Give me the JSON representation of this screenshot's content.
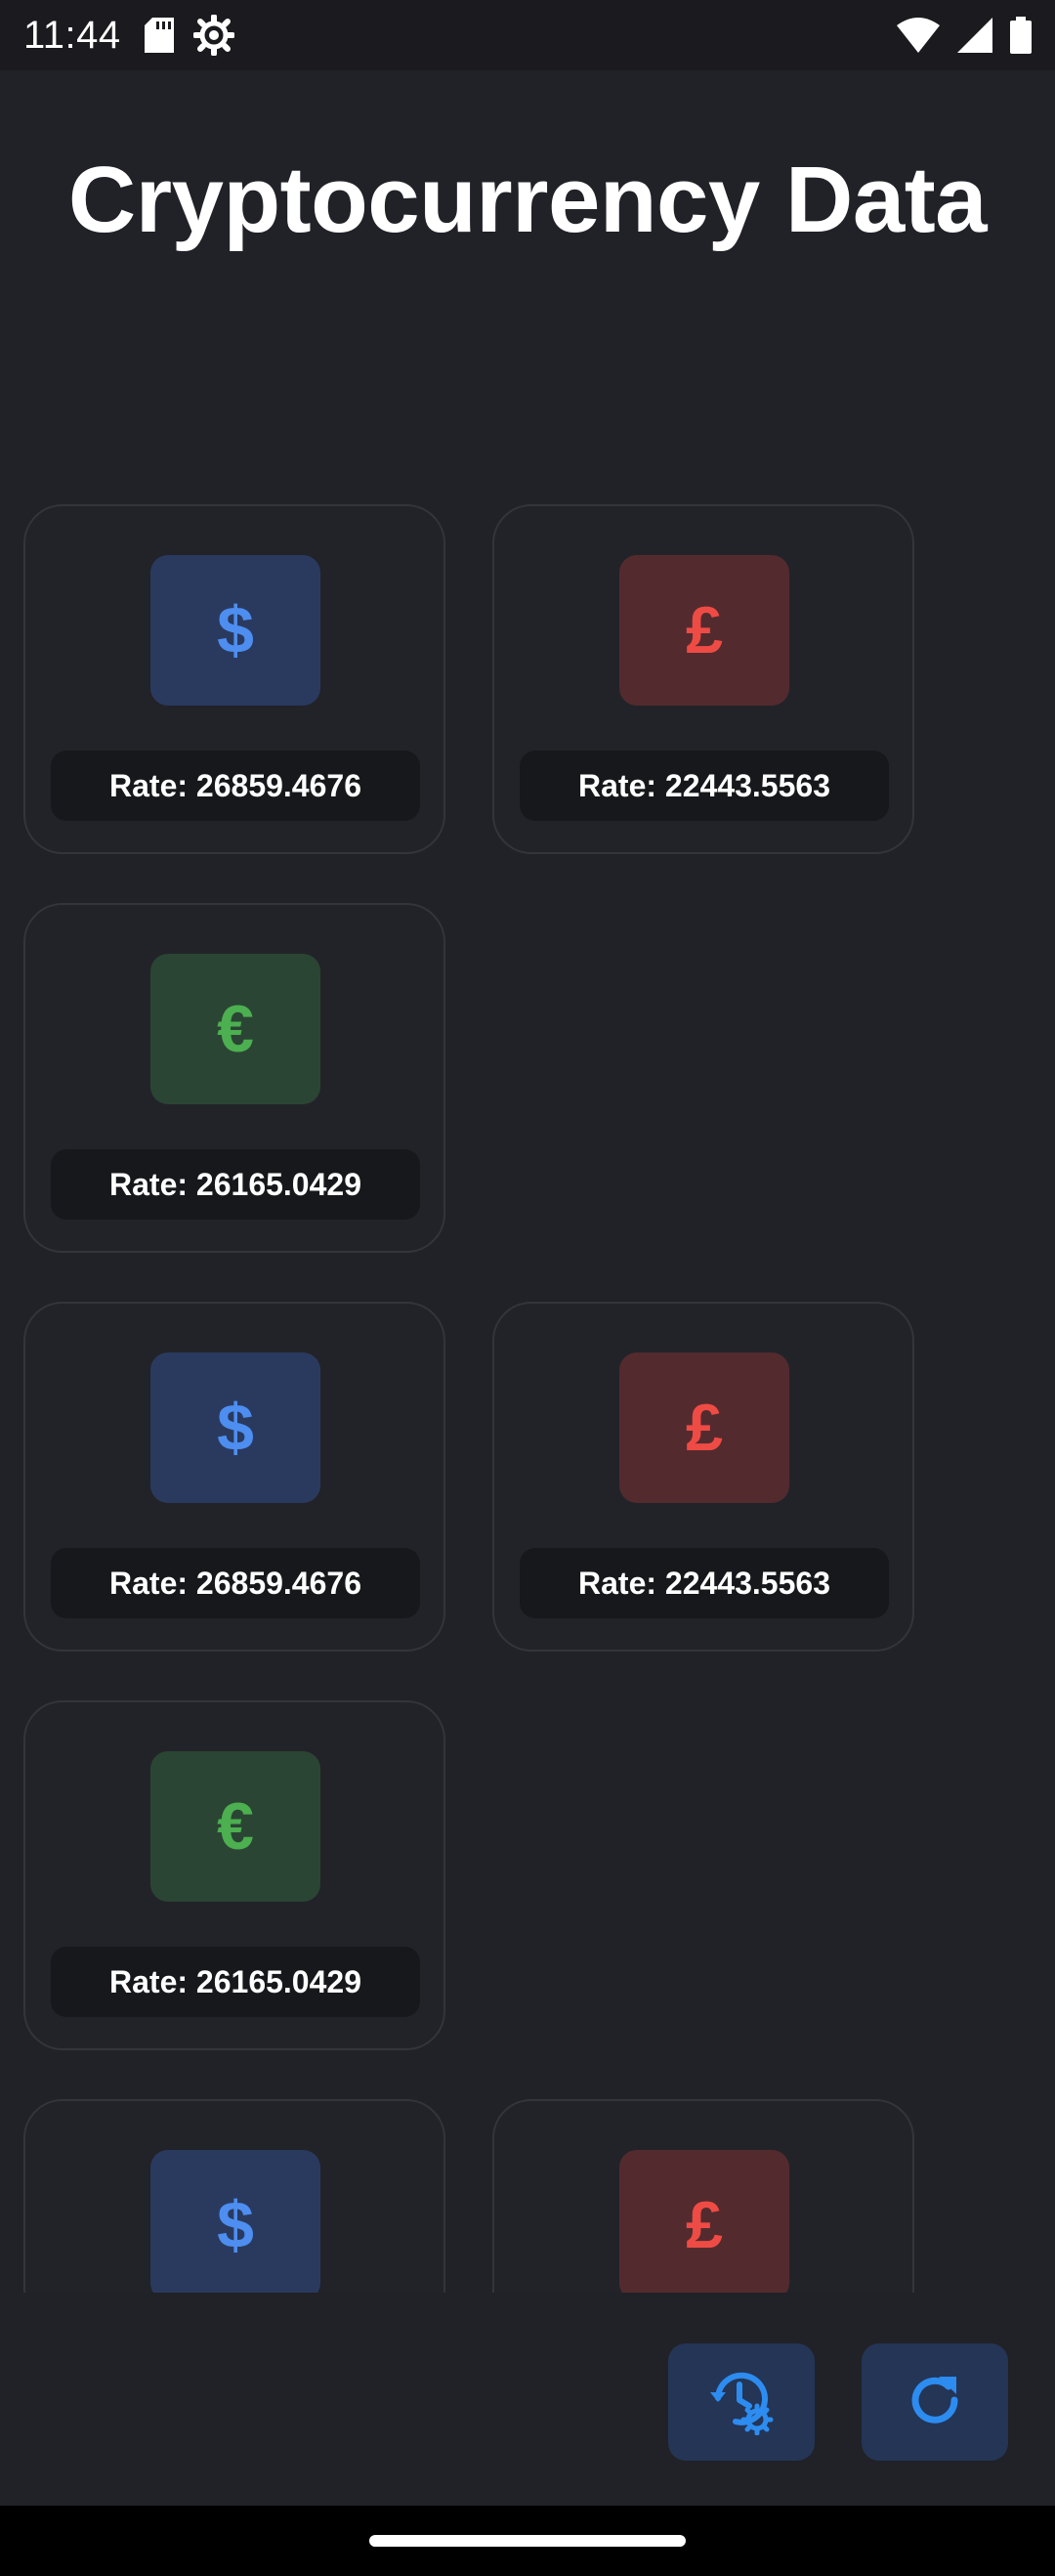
{
  "status_bar": {
    "time": "11:44",
    "left_icons": [
      "sd-card-icon",
      "settings-gear-icon"
    ],
    "right_icons": [
      "wifi-icon",
      "cellular-signal-icon",
      "battery-icon"
    ]
  },
  "header": {
    "title": "Cryptocurrency Data"
  },
  "cards": [
    {
      "currency_symbol": "$",
      "currency": "usd",
      "rate_label": "Rate: 26859.4676"
    },
    {
      "currency_symbol": "£",
      "currency": "gbp",
      "rate_label": "Rate: 22443.5563"
    },
    {
      "currency_symbol": "€",
      "currency": "eur",
      "rate_label": "Rate: 26165.0429"
    },
    {
      "currency_symbol": "$",
      "currency": "usd",
      "rate_label": "Rate: 26859.4676"
    },
    {
      "currency_symbol": "£",
      "currency": "gbp",
      "rate_label": "Rate: 22443.5563"
    },
    {
      "currency_symbol": "€",
      "currency": "eur",
      "rate_label": "Rate: 26165.0429"
    },
    {
      "currency_symbol": "$",
      "currency": "usd",
      "rate_label": ""
    },
    {
      "currency_symbol": "£",
      "currency": "gbp",
      "rate_label": ""
    }
  ],
  "actions": {
    "history_settings_icon": "history-settings-icon",
    "refresh_icon": "refresh-icon"
  },
  "colors": {
    "background": "#212227",
    "usd_fg": "#4d8ef0",
    "gbp_fg": "#ef4b45",
    "eur_fg": "#4caf50",
    "action_icon": "#2d8cf0"
  }
}
